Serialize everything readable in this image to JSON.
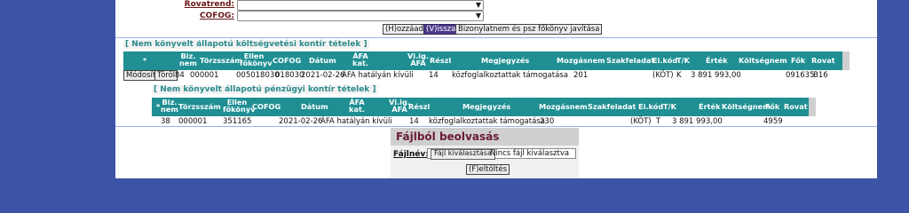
{
  "form": {
    "rovatrend_label": "Rovatrend:",
    "cofog_label": "COFOG:",
    "rovatrend_value": "",
    "cofog_value": ""
  },
  "buttons": {
    "hozzaad": "(H)ozzáad",
    "vissza": "(V)issza",
    "javitas": "Bizonylatnem és psz főkönyv javítása"
  },
  "budget_section": {
    "title": "[ Nem könyvelt állapotú  költségvetési kontír tételek ]",
    "headers": [
      "*",
      "Biz. nem",
      "Törzsszám",
      "Ellen főkönyv",
      "COFOG",
      "Dátum",
      "ÁFA kat.",
      "Vi.ig. ÁFA",
      "Részl",
      "Megjegyzés",
      "Mozgásnem",
      "Szakfeladat",
      "Ei.kód",
      "T/K",
      "Érték",
      "Költségnem",
      "Fők",
      "Rovat"
    ],
    "row": {
      "modify_label": "Módosít",
      "delete_label": "Töröl",
      "biz_nem": "84",
      "torzsszam": "000001",
      "ellen_fokonyv": "005018030",
      "cofog": "018030",
      "datum": "2021-02-26",
      "afa_kat": "ÁFA hatályán kívüli",
      "reszl": "14",
      "megjegyzes": "közfoglalkoztattak támogatása",
      "mozgasnem": "201",
      "ei_kod": "(KÖT)",
      "tk": "K",
      "ertek": "3 891 993,00",
      "fok": "091635",
      "rovat": "B16"
    }
  },
  "financial_section": {
    "title": "[ Nem könyvelt állapotú pénzügyi kontír tételek ]",
    "headers": [
      "*",
      "Biz. nem",
      "Törzsszám",
      "Ellen főkönyv",
      "COFOG",
      "Dátum",
      "ÁFA kat.",
      "Vi.ig. ÁFA",
      "Részl",
      "Megjegyzés",
      "Mozgásnem",
      "Szakfeladat",
      "Ei.kód",
      "T/K",
      "Érték",
      "Költségnem",
      "Fők",
      "Rovat"
    ],
    "row": {
      "biz_nem": "38",
      "torzsszam": "000001",
      "ellen_fokonyv": "351165",
      "datum": "2021-02-26",
      "afa_kat": "ÁFA hatályán kívüli",
      "reszl": "14",
      "megjegyzes": "közfoglalkoztattak támogatása",
      "mozgasnem": "230",
      "ei_kod": "(KÖT)",
      "tk": "T",
      "ertek": "3 891 993,00",
      "fok": "4959"
    }
  },
  "file_panel": {
    "title": "Fájlból beolvasás",
    "label": "Fájlnév:",
    "choose_button": "Fájl kiválasztása",
    "no_file_text": "Nincs fájl kiválasztva",
    "upload_button": "(F)eltöltés"
  },
  "colors": {
    "background": "#3c53a6",
    "table_header": "#1f8f93",
    "section_title": "#2a8a8a",
    "panel_title": "#6a1a3a"
  }
}
